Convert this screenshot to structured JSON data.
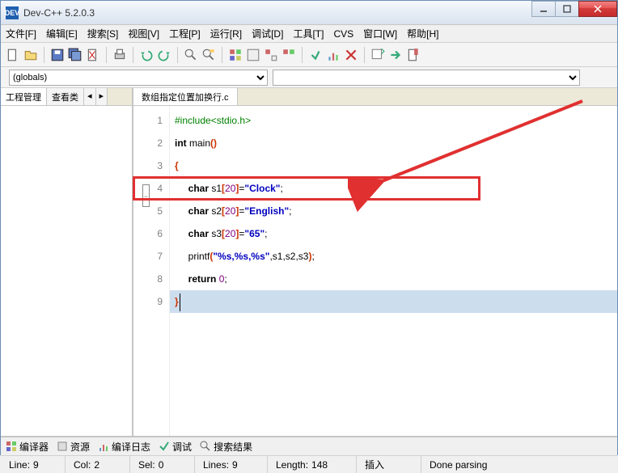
{
  "window": {
    "title": "Dev-C++ 5.2.0.3",
    "app_icon_text": "DEV"
  },
  "menu": {
    "file": "文件[F]",
    "edit": "编辑[E]",
    "search": "搜索[S]",
    "view": "视图[V]",
    "project": "工程[P]",
    "run": "运行[R]",
    "debug": "调试[D]",
    "tools": "工具[T]",
    "cvs": "CVS",
    "window": "窗口[W]",
    "help": "帮助[H]"
  },
  "combo": {
    "globals_label": "(globals)"
  },
  "left_tabs": {
    "project_mgmt": "工程管理",
    "view_class": "查看类"
  },
  "file_tab": {
    "name": "数组指定位置加换行.c"
  },
  "code": {
    "lines": [
      {
        "n": 1,
        "tokens": [
          [
            "pre",
            "#include"
          ],
          [
            "pre",
            "<stdio.h>"
          ]
        ]
      },
      {
        "n": 2,
        "tokens": [
          [
            "kw",
            "int"
          ],
          [
            "txt",
            " main"
          ],
          [
            "brk",
            "()"
          ]
        ]
      },
      {
        "n": 3,
        "tokens": [
          [
            "brk",
            "{"
          ]
        ],
        "fold": true
      },
      {
        "n": 4,
        "tokens": [
          [
            "txt",
            "     "
          ],
          [
            "kw",
            "char"
          ],
          [
            "txt",
            " s1"
          ],
          [
            "brk",
            "["
          ],
          [
            "num",
            "20"
          ],
          [
            "brk",
            "]"
          ],
          [
            "txt",
            "="
          ],
          [
            "str",
            "\"Clock\""
          ],
          [
            "txt",
            ";"
          ]
        ],
        "highlight": true
      },
      {
        "n": 5,
        "tokens": [
          [
            "txt",
            "     "
          ],
          [
            "kw",
            "char"
          ],
          [
            "txt",
            " s2"
          ],
          [
            "brk",
            "["
          ],
          [
            "num",
            "20"
          ],
          [
            "brk",
            "]"
          ],
          [
            "txt",
            "="
          ],
          [
            "str",
            "\"English\""
          ],
          [
            "txt",
            ";"
          ]
        ]
      },
      {
        "n": 6,
        "tokens": [
          [
            "txt",
            "     "
          ],
          [
            "kw",
            "char"
          ],
          [
            "txt",
            " s3"
          ],
          [
            "brk",
            "["
          ],
          [
            "num",
            "20"
          ],
          [
            "brk",
            "]"
          ],
          [
            "txt",
            "="
          ],
          [
            "str",
            "\"65\""
          ],
          [
            "txt",
            ";"
          ]
        ]
      },
      {
        "n": 7,
        "tokens": [
          [
            "txt",
            "     printf"
          ],
          [
            "brk",
            "("
          ],
          [
            "str",
            "\"%s,%s,%s\""
          ],
          [
            "txt",
            ",s1,s2,s3"
          ],
          [
            "brk",
            ")"
          ],
          [
            "txt",
            ";"
          ]
        ]
      },
      {
        "n": 8,
        "tokens": [
          [
            "txt",
            "     "
          ],
          [
            "kw",
            "return"
          ],
          [
            "txt",
            " "
          ],
          [
            "num",
            "0"
          ],
          [
            "txt",
            ";"
          ]
        ]
      },
      {
        "n": 9,
        "tokens": [
          [
            "brk",
            "}"
          ]
        ],
        "active": true
      }
    ]
  },
  "bottom_tabs": {
    "compiler": "编译器",
    "resources": "资源",
    "compile_log": "编译日志",
    "debug": "调试",
    "search_results": "搜索结果"
  },
  "status": {
    "line_label": "Line:",
    "line_val": "9",
    "col_label": "Col:",
    "col_val": "2",
    "sel_label": "Sel:",
    "sel_val": "0",
    "lines_label": "Lines:",
    "lines_val": "9",
    "length_label": "Length:",
    "length_val": "148",
    "insert": "插入",
    "done": "Done parsing"
  }
}
